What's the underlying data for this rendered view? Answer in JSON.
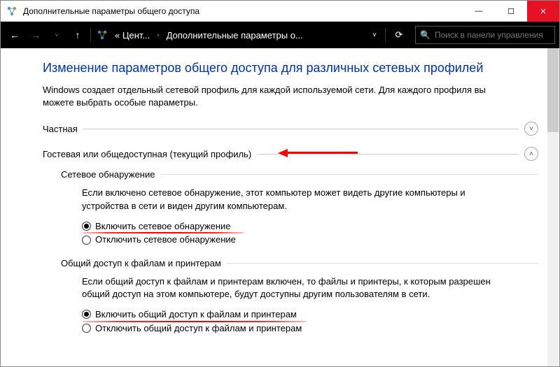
{
  "titlebar": {
    "title": "Дополнительные параметры общего доступа"
  },
  "window_controls": {
    "minimize": "—",
    "maximize": "☐",
    "close": "✕"
  },
  "nav": {
    "back": "←",
    "forward": "→",
    "up": "↑",
    "crumb1": "« Цент...",
    "crumb2": "Дополнительные параметры о...",
    "dropdown": "˅",
    "refresh": "⟳",
    "search_placeholder": "Поиск в панели управления"
  },
  "main": {
    "heading": "Изменение параметров общего доступа для различных сетевых профилей",
    "description": "Windows создает отдельный сетевой профиль для каждой используемой сети. Для каждого профиля вы можете выбрать особые параметры."
  },
  "sections": {
    "private": {
      "label": "Частная",
      "chevron": "˅"
    },
    "guest": {
      "label": "Гостевая или общедоступная (текущий профиль)",
      "chevron": "˄"
    }
  },
  "network_discovery": {
    "title": "Сетевое обнаружение",
    "desc": "Если включено сетевое обнаружение, этот компьютер может видеть другие компьютеры и устройства в сети и виден другим компьютерам.",
    "opt_on": "Включить сетевое обнаружение",
    "opt_off": "Отключить сетевое обнаружение"
  },
  "file_sharing": {
    "title": "Общий доступ к файлам и принтерам",
    "desc": "Если общий доступ к файлам и принтерам включен, то файлы и принтеры, к которым разрешен общий доступ на этом компьютере, будут доступны другим пользователям в сети.",
    "opt_on": "Включить общий доступ к файлам и принтерам",
    "opt_off": "Отключить общий доступ к файлам и принтерам"
  }
}
